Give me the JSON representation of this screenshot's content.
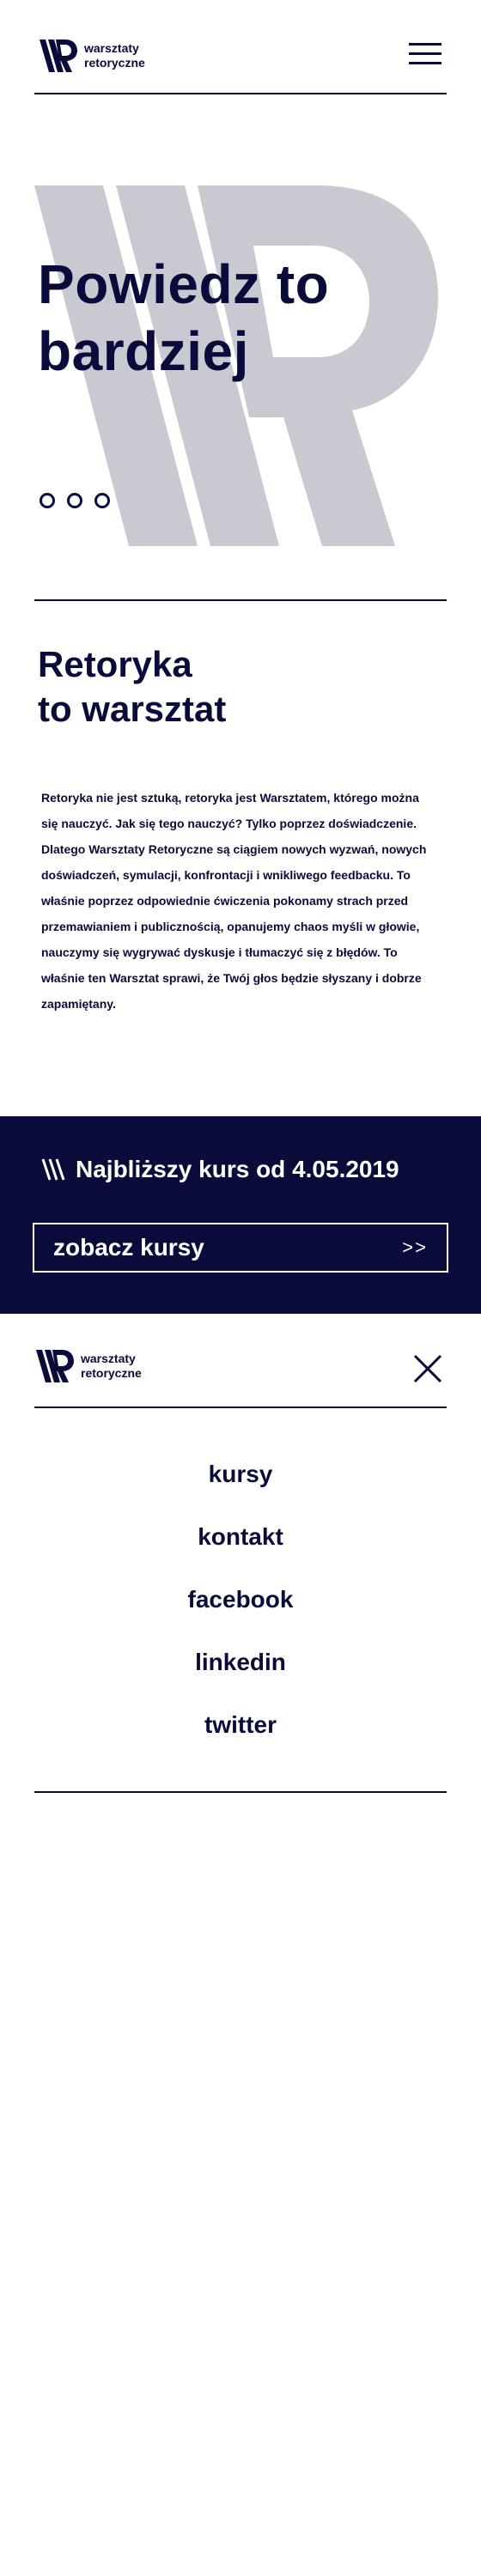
{
  "brand": {
    "line1": "warsztaty",
    "line2": "retoryczne"
  },
  "hero": {
    "title_line1": "Powiedz to",
    "title_line2": "bardziej",
    "slides_count": 3
  },
  "about": {
    "title_line1": "Retoryka",
    "title_line2": "to warsztat",
    "body": "Retoryka nie jest sztuką, retoryka jest Warsztatem, którego można się nauczyć. Jak się tego nauczyć? Tylko poprzez doświadczenie. Dlatego Warsztaty Retoryczne są ciągiem nowych wyzwań, nowych doświadczeń, symulacji, konfrontacji i wnikliwego feedbacku. To właśnie poprzez odpowiednie ćwiczenia pokonamy strach przed przemawianiem i publicznością, opanujemy chaos myśli w głowie, nauczymy się wygrywać dyskusje i tłumaczyć się z błędów. To właśnie ten Warsztat sprawi, że Twój głos będzie słyszany i dobrze zapamiętany."
  },
  "course": {
    "title": "Najbliższy kurs od 4.05.2019",
    "button_label": "zobacz kursy",
    "button_arrow": ">>"
  },
  "menu": {
    "items": [
      "kursy",
      "kontakt",
      "facebook",
      "linkedin",
      "twitter"
    ]
  },
  "colors": {
    "navy": "#0b0b3b",
    "hero_watermark": "#c9c9d2",
    "white": "#ffffff"
  },
  "icons": {
    "logo": "wr-logo-icon",
    "menu": "hamburger-icon",
    "close": "close-icon",
    "slashes": "triple-slash-icon",
    "arrow": "double-chevron-right-icon"
  }
}
